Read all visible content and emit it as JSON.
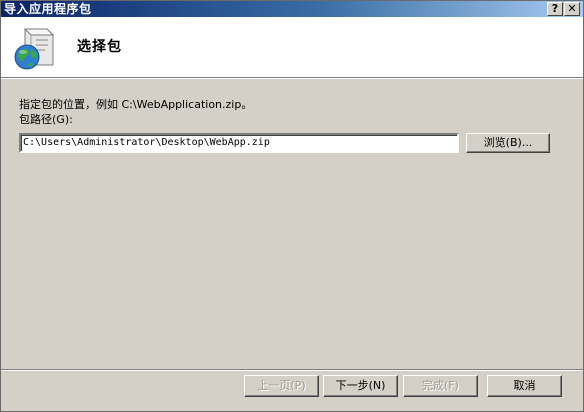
{
  "window": {
    "title": "导入应用程序包",
    "help_glyph": "?",
    "close_glyph": "✕"
  },
  "header": {
    "title": "选择包",
    "icon": "package-globe-icon"
  },
  "content": {
    "description": "指定包的位置，例如 C:\\WebApplication.zip。",
    "path_label": "包路径(G):",
    "path_value": "C:\\Users\\Administrator\\Desktop\\WebApp.zip",
    "browse_label": "浏览(B)..."
  },
  "footer": {
    "back_label": "上一页(P)",
    "next_label": "下一步(N)",
    "finish_label": "完成(F)",
    "cancel_label": "取消"
  },
  "colors": {
    "titlebar_start": "#0a246a",
    "titlebar_end": "#a6caf0",
    "dialog_bg": "#d4d0c8"
  }
}
